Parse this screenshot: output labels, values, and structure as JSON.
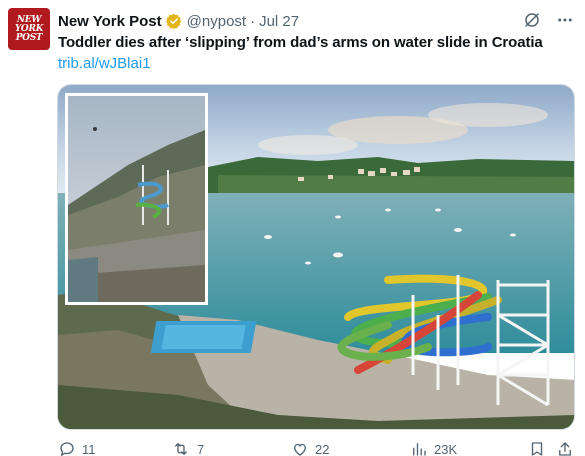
{
  "account": {
    "avatar_lines": [
      "NEW",
      "YORK",
      "POST"
    ],
    "name": "New York Post",
    "handle": "@nypost",
    "separator": "·",
    "date": "Jul 27",
    "verified_badge": "gold-check"
  },
  "tweet": {
    "text": "Toddler dies after ‘slipping’ from dad’s arms on water slide in Croatia",
    "link": "trib.al/wJBlai1"
  },
  "actions": {
    "replies": "11",
    "retweets": "7",
    "likes": "22",
    "views": "23K"
  },
  "colors": {
    "accent": "#1d9bf0",
    "muted": "#536471",
    "brand": "#b0191e",
    "badge": "#e2b719"
  }
}
